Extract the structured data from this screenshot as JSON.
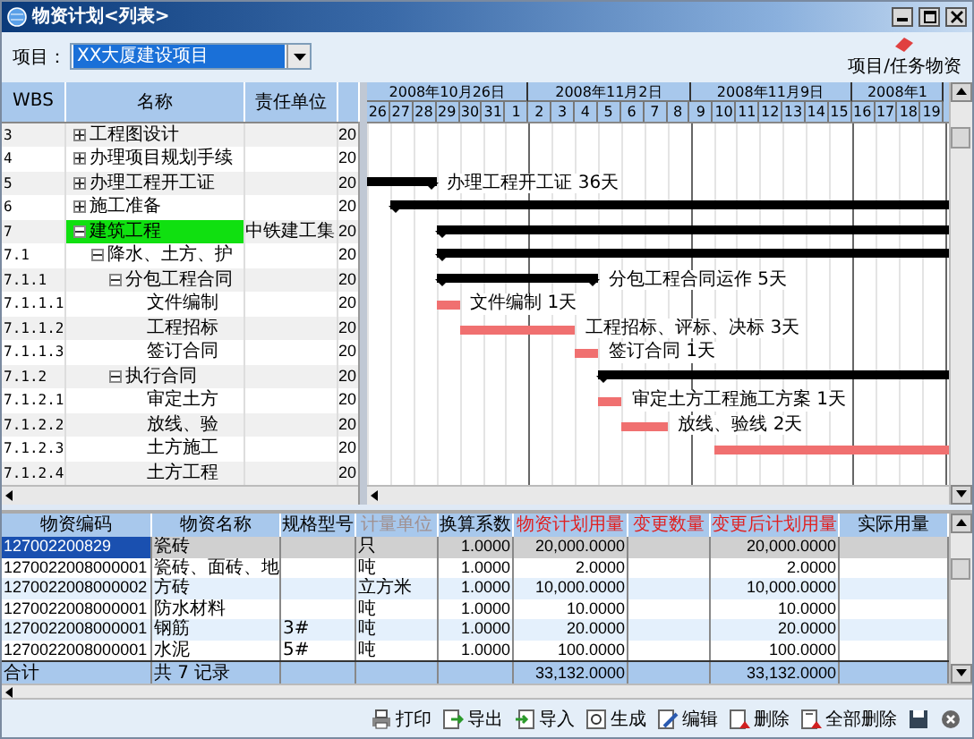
{
  "window": {
    "title": "物资计划<列表>"
  },
  "toolbar": {
    "project_label": "项目：",
    "project_value": "XX大厦建设项目",
    "link_label": "项目/任务物资"
  },
  "tree_columns": [
    "WBS",
    "名称",
    "责任单位"
  ],
  "timeline": {
    "weeks": [
      "2008年10月26日",
      "2008年11月2日",
      "2008年11月9日",
      "2008年1"
    ],
    "days": [
      "26",
      "27",
      "28",
      "29",
      "30",
      "31",
      "1",
      "2",
      "3",
      "4",
      "5",
      "6",
      "7",
      "8",
      "9",
      "10",
      "11",
      "12",
      "13",
      "14",
      "15",
      "16",
      "17",
      "18",
      "19"
    ]
  },
  "tasks": [
    {
      "wbs": "3",
      "name": "工程图设计",
      "expanded": false,
      "selected": false,
      "column_4": "20"
    },
    {
      "wbs": "4",
      "name": "办理项目规划手续",
      "expanded": false,
      "selected": false,
      "column_4": "20"
    },
    {
      "wbs": "5",
      "name": "办理工程开工证",
      "expanded": false,
      "selected": false,
      "column_4": "20",
      "bar": {
        "kind": "summary",
        "label": "办理工程开工证 36天"
      }
    },
    {
      "wbs": "6",
      "name": "施工准备",
      "expanded": false,
      "selected": false,
      "column_4": "20",
      "bar": {
        "kind": "summary"
      }
    },
    {
      "wbs": "7",
      "name": "建筑工程",
      "expanded": true,
      "selected": true,
      "unit": "中铁建工集",
      "column_4": "20",
      "bar": {
        "kind": "summary"
      },
      "children": [
        {
          "wbs": "7.1",
          "name": "降水、土方、护",
          "expanded": true,
          "selected": false,
          "column_4": "20",
          "bar": {
            "kind": "summary"
          },
          "children": [
            {
              "wbs": "7.1.1",
              "name": "分包工程合同",
              "expanded": true,
              "selected": false,
              "column_4": "20",
              "bar": {
                "kind": "summary",
                "label": "分包工程合同运作 5天"
              },
              "children": [
                {
                  "wbs": "7.1.1.1",
                  "name": "文件编制",
                  "selected": false,
                  "column_4": "20",
                  "bar": {
                    "kind": "task",
                    "label": "文件编制 1天"
                  }
                },
                {
                  "wbs": "7.1.1.2",
                  "name": "工程招标",
                  "selected": false,
                  "column_4": "20",
                  "bar": {
                    "kind": "task",
                    "label": "工程招标、评标、决标 3天"
                  }
                },
                {
                  "wbs": "7.1.1.3",
                  "name": "签订合同",
                  "selected": false,
                  "column_4": "20",
                  "bar": {
                    "kind": "task",
                    "label": "签订合同 1天"
                  }
                }
              ]
            },
            {
              "wbs": "7.1.2",
              "name": "执行合同",
              "expanded": true,
              "selected": false,
              "column_4": "20",
              "bar": {
                "kind": "summary"
              },
              "children": [
                {
                  "wbs": "7.1.2.1",
                  "name": "审定土方",
                  "selected": false,
                  "column_4": "20",
                  "bar": {
                    "kind": "task",
                    "label": "审定土方工程施工方案 1天"
                  }
                },
                {
                  "wbs": "7.1.2.2",
                  "name": "放线、验",
                  "selected": false,
                  "column_4": "20",
                  "bar": {
                    "kind": "task",
                    "label": "放线、验线 2天"
                  }
                },
                {
                  "wbs": "7.1.2.3",
                  "name": "土方施工",
                  "selected": false,
                  "column_4": "20",
                  "bar": {
                    "kind": "task"
                  }
                },
                {
                  "wbs": "7.1.2.4",
                  "name": "土方工程",
                  "selected": false,
                  "column_4": "20"
                }
              ]
            }
          ]
        }
      ]
    }
  ],
  "materials": {
    "columns": [
      {
        "label": "物资编码"
      },
      {
        "label": "物资名称"
      },
      {
        "label": "规格型号"
      },
      {
        "label": "计量单位",
        "color": "#a09090"
      },
      {
        "label": "换算系数"
      },
      {
        "label": "物资计划用量",
        "color": "#e02020"
      },
      {
        "label": "变更数量",
        "color": "#e02020"
      },
      {
        "label": "变更后计划用量",
        "color": "#e02020"
      },
      {
        "label": "实际用量"
      }
    ],
    "rows": [
      {
        "selected": true,
        "cells": [
          "127002200829",
          "瓷砖",
          null,
          "只",
          "1.0000",
          "20,000.0000",
          null,
          "20,000.0000",
          null
        ]
      },
      {
        "selected": false,
        "cells": [
          "1270022008000001",
          "瓷砖、面砖、地",
          null,
          "吨",
          "1.0000",
          "2.0000",
          null,
          "2.0000",
          null
        ]
      },
      {
        "selected": false,
        "cells": [
          "1270022008000002",
          "方砖",
          null,
          "立方米",
          "1.0000",
          "10,000.0000",
          null,
          "10,000.0000",
          null
        ]
      },
      {
        "selected": false,
        "cells": [
          "1270022008000001",
          "防水材料",
          null,
          "吨",
          "1.0000",
          "10.0000",
          null,
          "10.0000",
          null
        ]
      },
      {
        "selected": false,
        "cells": [
          "1270022008000001",
          "钢筋",
          "3#",
          "吨",
          "1.0000",
          "20.0000",
          null,
          "20.0000",
          null
        ]
      },
      {
        "selected": false,
        "cells": [
          "1270022008000001",
          "水泥",
          "5#",
          "吨",
          "1.0000",
          "100.0000",
          null,
          "100.0000",
          null
        ]
      }
    ],
    "totals": {
      "label": "合计",
      "record_count": "共 7 记录",
      "planned_total": "33,132.0000",
      "changed_total": "33,132.0000"
    }
  },
  "footer_buttons": [
    "打印",
    "导出",
    "导入",
    "生成",
    "编辑",
    "删除",
    "全部删除"
  ]
}
